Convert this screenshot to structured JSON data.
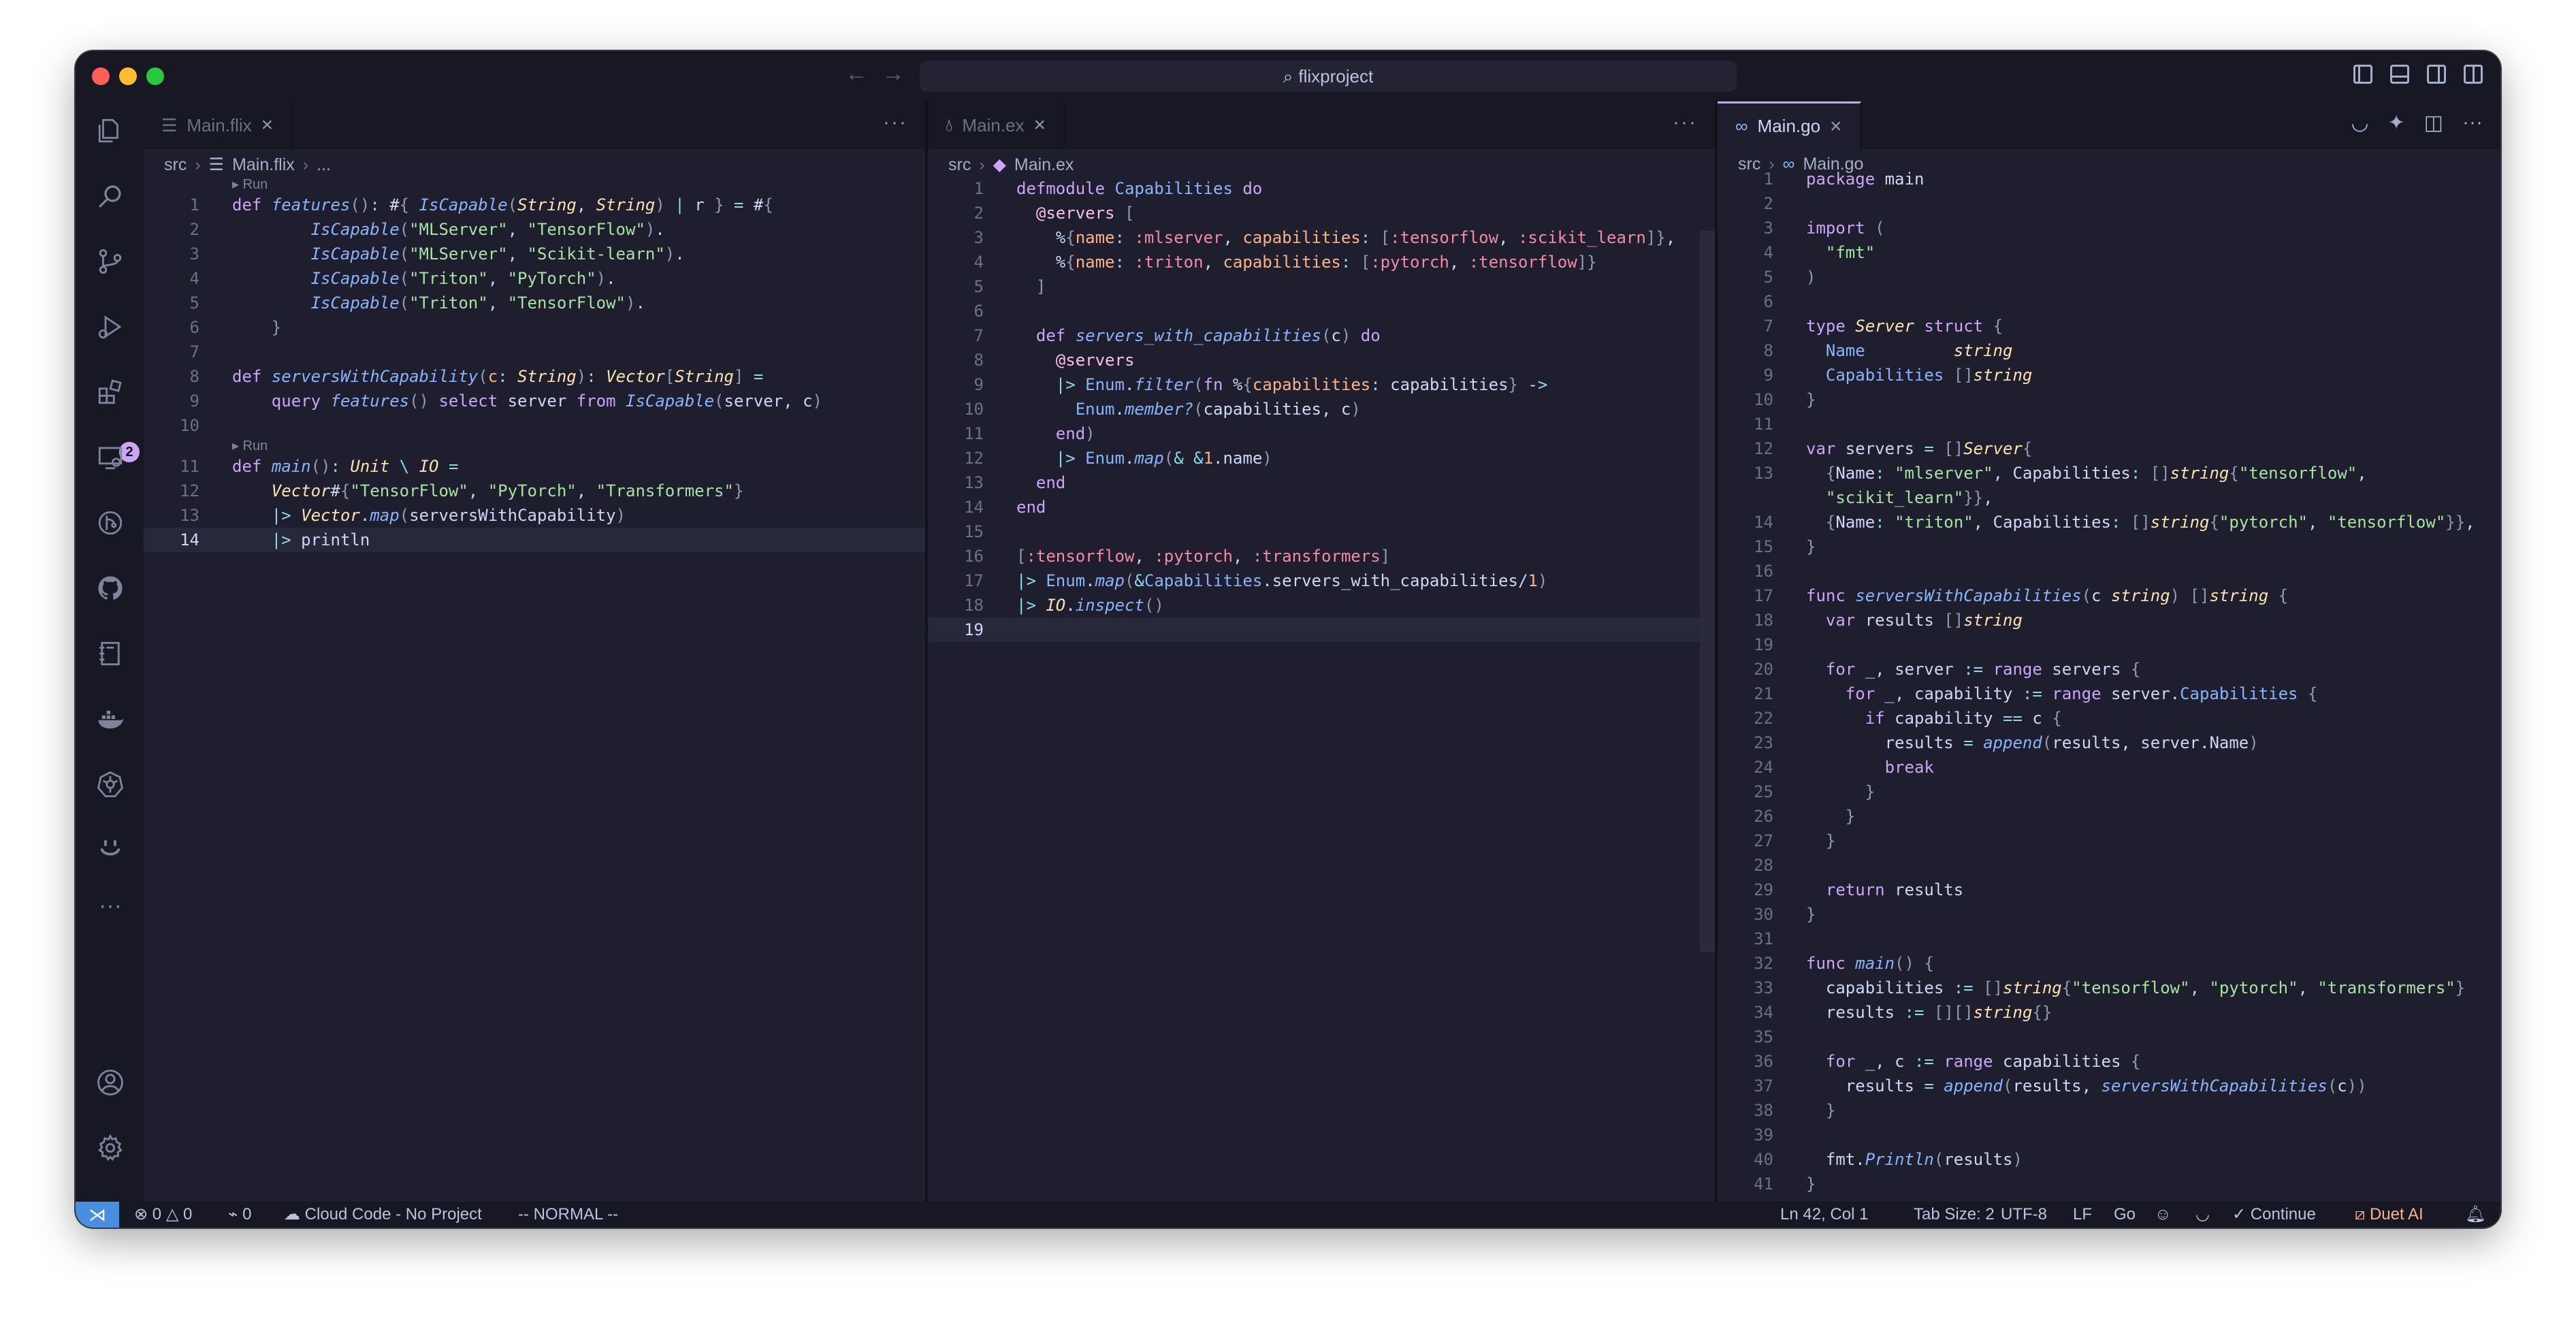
{
  "window": {
    "search": "flixproject"
  },
  "activity_bar": {
    "badge": "2",
    "more": "···"
  },
  "panes": [
    {
      "tab": {
        "label": "Main.flix",
        "icon": "lines-file-icon"
      },
      "breadcrumb": [
        "src",
        "Main.flix",
        "..."
      ],
      "lens": "Run",
      "lines": [
        {
          "n": "1",
          "t": "def features(): #{ IsCapable(String, String) | r } = #{"
        },
        {
          "n": "2",
          "t": "        IsCapable(\"MLServer\", \"TensorFlow\")."
        },
        {
          "n": "3",
          "t": "        IsCapable(\"MLServer\", \"Scikit-learn\")."
        },
        {
          "n": "4",
          "t": "        IsCapable(\"Triton\", \"PyTorch\")."
        },
        {
          "n": "5",
          "t": "        IsCapable(\"Triton\", \"TensorFlow\")."
        },
        {
          "n": "6",
          "t": "    }"
        },
        {
          "n": "7",
          "t": ""
        },
        {
          "n": "8",
          "t": "def serversWithCapability(c: String): Vector[String] ="
        },
        {
          "n": "9",
          "t": "    query features() select server from IsCapable(server, c)"
        },
        {
          "n": "10",
          "t": ""
        },
        {
          "n": "11",
          "t": "def main(): Unit \\ IO ="
        },
        {
          "n": "12",
          "t": "    Vector#{\"TensorFlow\", \"PyTorch\", \"Transformers\"}"
        },
        {
          "n": "13",
          "t": "    |> Vector.map(serversWithCapability)"
        },
        {
          "n": "14",
          "t": "    |> println"
        }
      ]
    },
    {
      "tab": {
        "label": "Main.ex",
        "icon": "elixir-drop-icon"
      },
      "breadcrumb": [
        "src",
        "Main.ex"
      ],
      "lines": [
        {
          "n": "1",
          "t": "defmodule Capabilities do"
        },
        {
          "n": "2",
          "t": "  @servers ["
        },
        {
          "n": "3",
          "t": "    %{name: :mlserver, capabilities: [:tensorflow, :scikit_learn]},"
        },
        {
          "n": "4",
          "t": "    %{name: :triton, capabilities: [:pytorch, :tensorflow]}"
        },
        {
          "n": "5",
          "t": "  ]"
        },
        {
          "n": "6",
          "t": ""
        },
        {
          "n": "7",
          "t": "  def servers_with_capabilities(c) do"
        },
        {
          "n": "8",
          "t": "    @servers"
        },
        {
          "n": "9",
          "t": "    |> Enum.filter(fn %{capabilities: capabilities} ->"
        },
        {
          "n": "10",
          "t": "      Enum.member?(capabilities, c)"
        },
        {
          "n": "11",
          "t": "    end)"
        },
        {
          "n": "12",
          "t": "    |> Enum.map(& &1.name)"
        },
        {
          "n": "13",
          "t": "  end"
        },
        {
          "n": "14",
          "t": "end"
        },
        {
          "n": "15",
          "t": ""
        },
        {
          "n": "16",
          "t": "[:tensorflow, :pytorch, :transformers]"
        },
        {
          "n": "17",
          "t": "|> Enum.map(&Capabilities.servers_with_capabilities/1)"
        },
        {
          "n": "18",
          "t": "|> IO.inspect()"
        },
        {
          "n": "19",
          "t": ""
        }
      ]
    },
    {
      "tab": {
        "label": "Main.go",
        "icon": "go-icon"
      },
      "breadcrumb": [
        "src",
        "Main.go"
      ],
      "lines": [
        {
          "n": "1",
          "t": "package main"
        },
        {
          "n": "2",
          "t": ""
        },
        {
          "n": "3",
          "t": "import ("
        },
        {
          "n": "4",
          "t": "  \"fmt\""
        },
        {
          "n": "5",
          "t": ")"
        },
        {
          "n": "6",
          "t": ""
        },
        {
          "n": "7",
          "t": "type Server struct {"
        },
        {
          "n": "8",
          "t": "  Name         string"
        },
        {
          "n": "9",
          "t": "  Capabilities []string"
        },
        {
          "n": "10",
          "t": "}"
        },
        {
          "n": "11",
          "t": ""
        },
        {
          "n": "12",
          "t": "var servers = []Server{"
        },
        {
          "n": "13",
          "t": "  {Name: \"mlserver\", Capabilities: []string{\"tensorflow\","
        },
        {
          "n": "",
          "t": "  \"scikit_learn\"}},"
        },
        {
          "n": "14",
          "t": "  {Name: \"triton\", Capabilities: []string{\"pytorch\", \"tensorflow\"}},"
        },
        {
          "n": "15",
          "t": "}"
        },
        {
          "n": "16",
          "t": ""
        },
        {
          "n": "17",
          "t": "func serversWithCapabilities(c string) []string {"
        },
        {
          "n": "18",
          "t": "  var results []string"
        },
        {
          "n": "19",
          "t": ""
        },
        {
          "n": "20",
          "t": "  for _, server := range servers {"
        },
        {
          "n": "21",
          "t": "    for _, capability := range server.Capabilities {"
        },
        {
          "n": "22",
          "t": "      if capability == c {"
        },
        {
          "n": "23",
          "t": "        results = append(results, server.Name)"
        },
        {
          "n": "24",
          "t": "        break"
        },
        {
          "n": "25",
          "t": "      }"
        },
        {
          "n": "26",
          "t": "    }"
        },
        {
          "n": "27",
          "t": "  }"
        },
        {
          "n": "28",
          "t": ""
        },
        {
          "n": "29",
          "t": "  return results"
        },
        {
          "n": "30",
          "t": "}"
        },
        {
          "n": "31",
          "t": ""
        },
        {
          "n": "32",
          "t": "func main() {"
        },
        {
          "n": "33",
          "t": "  capabilities := []string{\"tensorflow\", \"pytorch\", \"transformers\"}"
        },
        {
          "n": "34",
          "t": "  results := [][]string{}"
        },
        {
          "n": "35",
          "t": ""
        },
        {
          "n": "36",
          "t": "  for _, c := range capabilities {"
        },
        {
          "n": "37",
          "t": "    results = append(results, serversWithCapabilities(c))"
        },
        {
          "n": "38",
          "t": "  }"
        },
        {
          "n": "39",
          "t": ""
        },
        {
          "n": "40",
          "t": "  fmt.Println(results)"
        },
        {
          "n": "41",
          "t": "}"
        }
      ]
    }
  ],
  "status": {
    "errors": "0",
    "warnings": "0",
    "ports": "0",
    "cloud": "Cloud Code - No Project",
    "mode": "-- NORMAL --",
    "position": "Ln 42, Col 1",
    "tab_size": "Tab Size: 2",
    "encoding": "UTF-8",
    "eol": "LF",
    "language": "Go",
    "continue": "Continue",
    "duet": "Duet AI"
  },
  "colors": {
    "accent": "#cba6f7",
    "remote": "#4a8ee0",
    "duet": "#fab387",
    "bg": "#1e1e2e",
    "chrome": "#181825"
  }
}
